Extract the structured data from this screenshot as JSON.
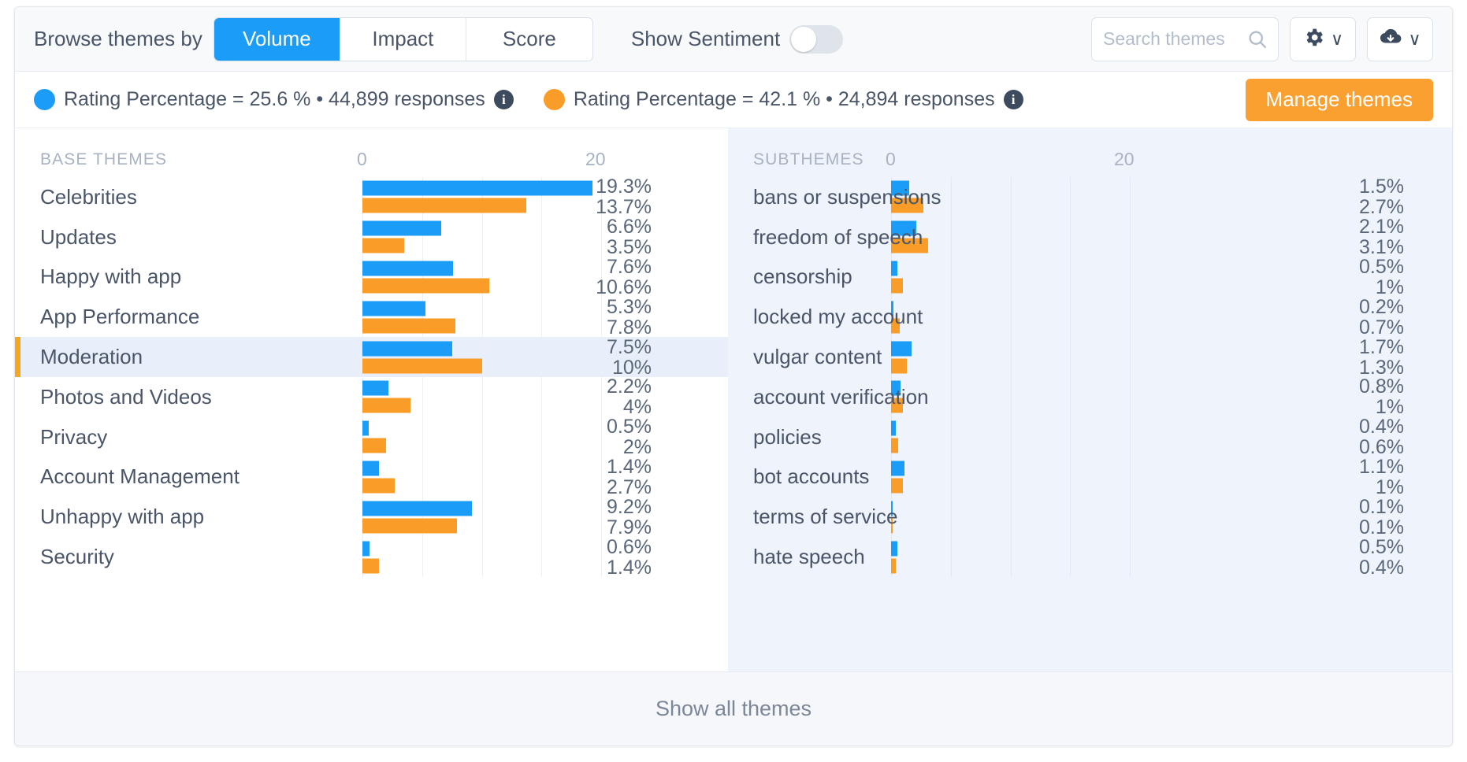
{
  "toolbar": {
    "browse_label": "Browse themes by",
    "segments": [
      {
        "label": "Volume",
        "active": true
      },
      {
        "label": "Impact",
        "active": false
      },
      {
        "label": "Score",
        "active": false
      }
    ],
    "sentiment_label": "Show Sentiment",
    "sentiment_on": false,
    "search": {
      "placeholder": "Search themes",
      "value": ""
    },
    "gear_icon": "gear-icon",
    "gear_chevron": "∨",
    "download_icon": "cloud-download-icon",
    "download_chevron": "∨",
    "search_icon": "search-icon"
  },
  "legend": {
    "series_a": {
      "color": "#1b9df7",
      "text": "Rating Percentage = 25.6 % • 44,899 responses",
      "info_icon": "info-icon",
      "info_glyph": "i"
    },
    "series_b": {
      "color": "#fa9d28",
      "text": "Rating Percentage = 42.1 % • 24,894 responses",
      "info_icon": "info-icon",
      "info_glyph": "i"
    },
    "manage_button": "Manage themes"
  },
  "left_panel": {
    "title": "BASE THEMES",
    "axis_min": "0",
    "axis_max": "20"
  },
  "right_panel": {
    "title": "SUBTHEMES",
    "axis_min": "0",
    "axis_max": "20"
  },
  "footer": {
    "show_all": "Show all themes"
  },
  "colors": {
    "blue": "#1b9df7",
    "orange": "#fa9d28",
    "accent": "#f5a623",
    "selected_row_bg": "#e8effb",
    "right_panel_bg": "#eef3fc"
  },
  "chart_data": [
    {
      "type": "bar",
      "title": "BASE THEMES",
      "orientation": "horizontal",
      "xlabel": "",
      "ylabel": "",
      "xlim": [
        0,
        20
      ],
      "xticks": [
        "0",
        "20"
      ],
      "grid": true,
      "legend_position": "top",
      "categories": [
        "Celebrities",
        "Updates",
        "Happy with app",
        "App Performance",
        "Moderation",
        "Photos and Videos",
        "Privacy",
        "Account Management",
        "Unhappy with app",
        "Security"
      ],
      "series": [
        {
          "name": "Rating Percentage = 25.6 % • 44,899 responses",
          "color": "#1b9df7",
          "values": [
            19.3,
            6.6,
            7.6,
            5.3,
            7.5,
            2.2,
            0.5,
            1.4,
            9.2,
            0.6
          ],
          "labels": [
            "19.3%",
            "6.6%",
            "7.6%",
            "5.3%",
            "7.5%",
            "2.2%",
            "0.5%",
            "1.4%",
            "9.2%",
            "0.6%"
          ]
        },
        {
          "name": "Rating Percentage = 42.1 % • 24,894 responses",
          "color": "#fa9d28",
          "values": [
            13.7,
            3.5,
            10.6,
            7.8,
            10,
            4,
            2,
            2.7,
            7.9,
            1.4
          ],
          "labels": [
            "13.7%",
            "3.5%",
            "10.6%",
            "7.8%",
            "10%",
            "4%",
            "2%",
            "2.7%",
            "7.9%",
            "1.4%"
          ]
        }
      ],
      "selected_category": "Moderation"
    },
    {
      "type": "bar",
      "title": "SUBTHEMES",
      "orientation": "horizontal",
      "xlabel": "",
      "ylabel": "",
      "xlim": [
        0,
        20
      ],
      "xticks": [
        "0",
        "20"
      ],
      "grid": true,
      "legend_position": "top",
      "categories": [
        "bans or suspensions",
        "freedom of speech",
        "censorship",
        "locked my account",
        "vulgar content",
        "account verification",
        "policies",
        "bot accounts",
        "terms of service",
        "hate speech"
      ],
      "series": [
        {
          "name": "Rating Percentage = 25.6 % • 44,899 responses",
          "color": "#1b9df7",
          "values": [
            1.5,
            2.1,
            0.5,
            0.2,
            1.7,
            0.8,
            0.4,
            1.1,
            0.1,
            0.5
          ],
          "labels": [
            "1.5%",
            "2.1%",
            "0.5%",
            "0.2%",
            "1.7%",
            "0.8%",
            "0.4%",
            "1.1%",
            "0.1%",
            "0.5%"
          ]
        },
        {
          "name": "Rating Percentage = 42.1 % • 24,894 responses",
          "color": "#fa9d28",
          "values": [
            2.7,
            3.1,
            1,
            0.7,
            1.3,
            1,
            0.6,
            1,
            0.1,
            0.4
          ],
          "labels": [
            "2.7%",
            "3.1%",
            "1%",
            "0.7%",
            "1.3%",
            "1%",
            "0.6%",
            "1%",
            "0.1%",
            "0.4%"
          ]
        }
      ],
      "selected_category": null
    }
  ]
}
